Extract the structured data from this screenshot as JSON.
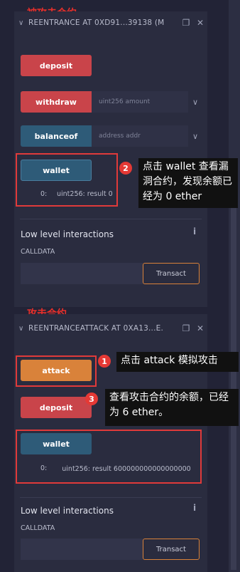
{
  "contract1": {
    "annotation": "被攻击合约",
    "title": "REENTRANCE AT 0XD91...39138 (M",
    "deposit_label": "deposit",
    "withdraw_label": "withdraw",
    "withdraw_placeholder": "uint256 amount",
    "balanceof_label": "balanceof",
    "balanceof_placeholder": "address addr",
    "wallet_label": "wallet",
    "wallet_result_index": "0:",
    "wallet_result": "uint256: result 0",
    "low_level_title": "Low level interactions",
    "calldata_label": "CALLDATA",
    "transact_label": "Transact"
  },
  "contract2": {
    "annotation": "攻击合约",
    "title": "REENTRANCEATTACK AT 0XA13...E.",
    "attack_label": "attack",
    "deposit_label": "deposit",
    "wallet_label": "wallet",
    "wallet_result_index": "0:",
    "wallet_result": "uint256: result 600000000000000000",
    "low_level_title": "Low level interactions",
    "calldata_label": "CALLDATA",
    "transact_label": "Transact"
  },
  "callouts": [
    {
      "number": "1",
      "text": "点击 attack 模拟攻击"
    },
    {
      "number": "2",
      "text": "点击 wallet 查看漏洞合约，发现余额已经为 0 ether"
    },
    {
      "number": "3",
      "text": "查看攻击合约的余额，已经为 6 ether。"
    }
  ],
  "icons": {
    "chevron": "chevron-down-icon",
    "copy": "copy-icon",
    "close": "close-icon",
    "info": "info-icon"
  },
  "colors": {
    "danger": "#c9444a",
    "call": "#2e5b78",
    "payable": "#d9823a",
    "annotation": "#e03a3a"
  }
}
